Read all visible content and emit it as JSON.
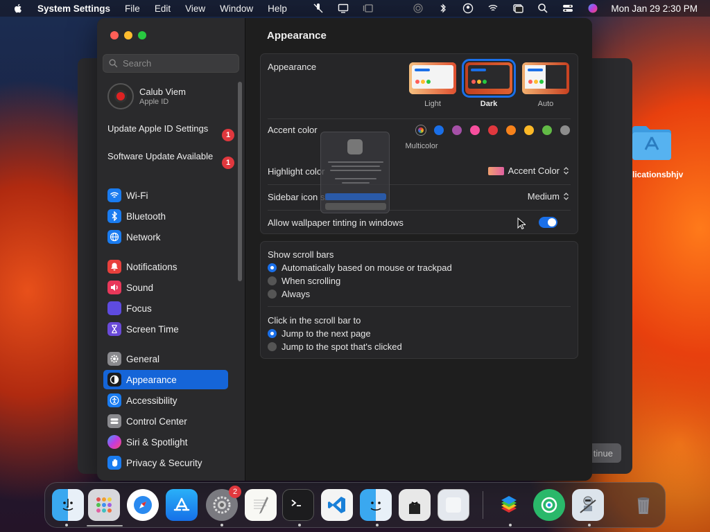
{
  "menubar": {
    "app_name": "System Settings",
    "menus": [
      "File",
      "Edit",
      "View",
      "Window",
      "Help"
    ],
    "clock": "Mon Jan 29  2:30 PM"
  },
  "desktop": {
    "folder_label": "licationsbhjv",
    "continue_label": "tinue"
  },
  "sidebar": {
    "search_placeholder": "Search",
    "user_name": "Calub Viem",
    "user_sub": "Apple ID",
    "notices": [
      {
        "label": "Update Apple ID Settings",
        "badge": "1"
      },
      {
        "label": "Software Update Available",
        "badge": "1"
      }
    ],
    "items": [
      {
        "label": "Wi-Fi",
        "icon": "wifi-icon",
        "color": "#1a7cf0"
      },
      {
        "label": "Bluetooth",
        "icon": "bluetooth-icon",
        "color": "#1a7cf0"
      },
      {
        "label": "Network",
        "icon": "globe-icon",
        "color": "#1a7cf0"
      },
      {
        "label": "Notifications",
        "icon": "bell-icon",
        "color": "#e8403c"
      },
      {
        "label": "Sound",
        "icon": "speaker-icon",
        "color": "#e8385a"
      },
      {
        "label": "Focus",
        "icon": "moon-icon",
        "color": "#5e4be0"
      },
      {
        "label": "Screen Time",
        "icon": "hourglass-icon",
        "color": "#6a4ad8"
      },
      {
        "label": "General",
        "icon": "gear-icon",
        "color": "#8a8a8e"
      },
      {
        "label": "Appearance",
        "icon": "appearance-icon",
        "color": "#1c1c1e"
      },
      {
        "label": "Accessibility",
        "icon": "accessibility-icon",
        "color": "#1a7cf0"
      },
      {
        "label": "Control Center",
        "icon": "control-center-icon",
        "color": "#8a8a8e"
      },
      {
        "label": "Siri & Spotlight",
        "icon": "siri-icon",
        "color": "#b03cd8"
      },
      {
        "label": "Privacy & Security",
        "icon": "hand-icon",
        "color": "#1a7cf0"
      }
    ],
    "active": "Appearance"
  },
  "content": {
    "title": "Appearance",
    "appearance_label": "Appearance",
    "appearance_options": [
      "Light",
      "Dark",
      "Auto"
    ],
    "appearance_selected": "Dark",
    "accent_label": "Accent color",
    "accent_colors": [
      "#1a6fe8",
      "#a550a7",
      "#f74f9e",
      "#e0383e",
      "#f7821b",
      "#fcb827",
      "#62ba46",
      "#8c8c8c"
    ],
    "accent_multicolor_label": "Multicolor",
    "highlight_label": "Highlight color",
    "highlight_value": "Accent Color",
    "sidebar_icon_label": "Sidebar icon size",
    "sidebar_icon_value": "Medium",
    "tinting_label": "Allow wallpaper tinting in windows",
    "tinting_on": true,
    "scrollbars_label": "Show scroll bars",
    "scrollbars_options": [
      "Automatically based on mouse or trackpad",
      "When scrolling",
      "Always"
    ],
    "scrollbars_selected": 0,
    "click_label": "Click in the scroll bar to",
    "click_options": [
      "Jump to the next page",
      "Jump to the spot that's clicked"
    ],
    "click_selected": 0,
    "help_label": "?"
  },
  "dock": {
    "settings_badge": "2"
  }
}
